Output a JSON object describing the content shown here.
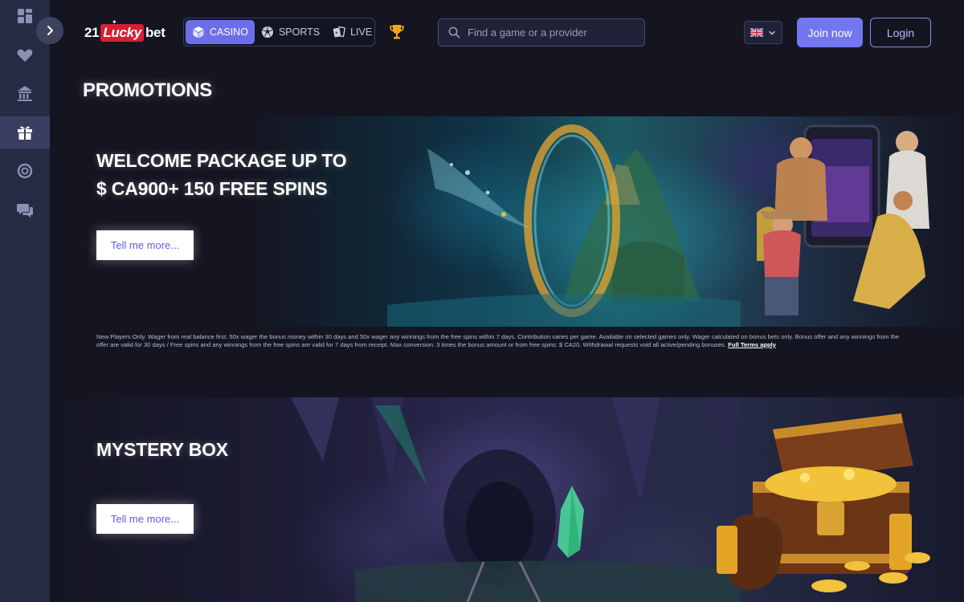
{
  "brand": {
    "logo_prefix": "21",
    "logo_lucky": "Lucky",
    "logo_suffix": "bet"
  },
  "sidebar": {
    "items": [
      {
        "name": "dashboard-icon"
      },
      {
        "name": "heart-icon"
      },
      {
        "name": "casino-building-icon"
      },
      {
        "name": "gift-icon",
        "active": true
      },
      {
        "name": "lifebuoy-icon"
      },
      {
        "name": "chat-support-icon"
      }
    ]
  },
  "header": {
    "tabs": [
      {
        "label": "CASINO",
        "icon": "cube-icon",
        "active": true
      },
      {
        "label": "SPORTS",
        "icon": "soccer-ball-icon"
      },
      {
        "label": "LIVE",
        "icon": "cards-icon"
      }
    ],
    "search_placeholder": "Find a game or a provider",
    "language": "GB",
    "join_label": "Join now",
    "login_label": "Login"
  },
  "page": {
    "title": "PROMOTIONS"
  },
  "promotions": [
    {
      "title_line1": "WELCOME PACKAGE UP TO",
      "title_line2": "$ CA900+ 150 FREE SPINS",
      "cta": "Tell me more...",
      "terms": "New Players Only. Wager from real balance first. 50x wager the bonus money within 30 days and 50x wager any winnings from the free spins within 7 days. Contribution varies per game. Available on selected games only. Wager calculated on bonus bets only. Bonus offer and any winnings from the offer are valid for 30 days / Free spins and any winnings from the free spins are valid for 7 days from receipt. Max conversion: 3 times the bonus amount or from free spins: $ CA20. Withdrawal requests void all active/pending bonuses.",
      "terms_link": "Full Terms apply"
    },
    {
      "title_line1": "MYSTERY BOX",
      "cta": "Tell me more..."
    }
  ],
  "colors": {
    "accent": "#7476f0",
    "sidebar_bg": "#262a43",
    "page_bg": "#141521",
    "logo_red": "#d51f34"
  }
}
